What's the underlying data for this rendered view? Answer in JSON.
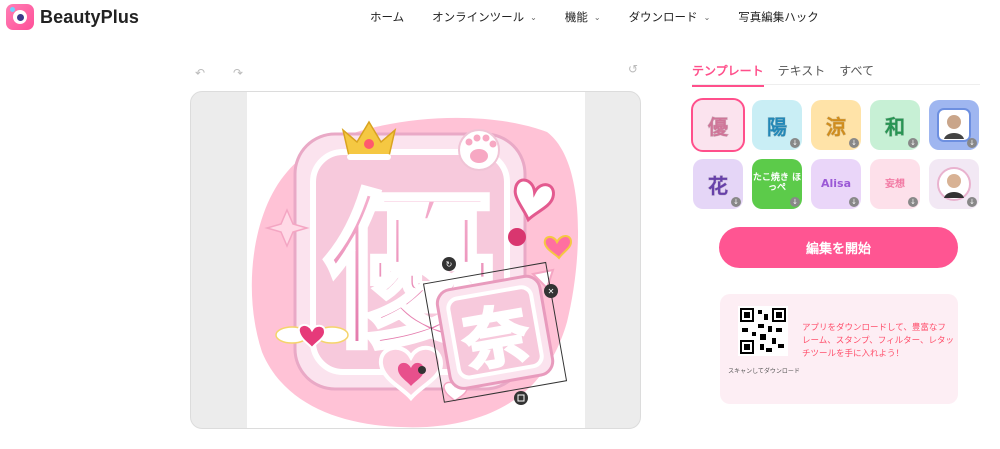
{
  "brand": {
    "name": "BeautyPlus"
  },
  "nav": [
    {
      "label": "ホーム",
      "has_dropdown": false
    },
    {
      "label": "オンラインツール",
      "has_dropdown": true
    },
    {
      "label": "機能",
      "has_dropdown": true
    },
    {
      "label": "ダウンロード",
      "has_dropdown": true
    },
    {
      "label": "写真編集ハック",
      "has_dropdown": false
    }
  ],
  "editor": {
    "icons": [
      "undo-icon",
      "redo-icon",
      "reset-icon"
    ],
    "canvas": {
      "main_text": "優",
      "sticker_text": "奈"
    }
  },
  "panel": {
    "tabs": [
      "テンプレート",
      "テキスト",
      "すべて"
    ],
    "active_tab": "テンプレート",
    "templates": [
      {
        "text": "優",
        "bg": "#f7c6da",
        "color": "#f48bb4",
        "selected": true
      },
      {
        "text": "陽",
        "bg": "#8fdbe8",
        "color": "#4fb3e8"
      },
      {
        "text": "涼",
        "bg": "#ffd27a",
        "color": "#f5a623"
      },
      {
        "text": "和",
        "bg": "#6fdc9a",
        "color": "#2fae62"
      },
      {
        "text": "",
        "bg": "#9fb6f0",
        "color": "#ffffff",
        "photo": true
      },
      {
        "text": "花",
        "bg": "#b793e6",
        "color": "#7a4cc8"
      },
      {
        "text": "たこ焼き ほっぺ",
        "bg": "#5ccb4a",
        "color": "#ffffff",
        "small": true
      },
      {
        "text": "Alisa",
        "bg": "#d7b6f2",
        "color": "#9b59d6",
        "small": true
      },
      {
        "text": "妄想",
        "bg": "#fde0ea",
        "color": "#f27aa4",
        "small": true
      },
      {
        "text": "",
        "bg": "#f2e8f4",
        "color": "#ffffff",
        "photo": true
      }
    ],
    "start_button": "編集を開始",
    "promo": {
      "qr_caption": "スキャンしてダウンロード",
      "text": "アプリをダウンロードして、豊富なフレーム、スタンプ、フィルター、レタッチツールを手に入れよう！"
    }
  },
  "colors": {
    "accent": "#ff5592",
    "promo_bg": "#fdeef4",
    "promo_text": "#ff4f6b"
  }
}
